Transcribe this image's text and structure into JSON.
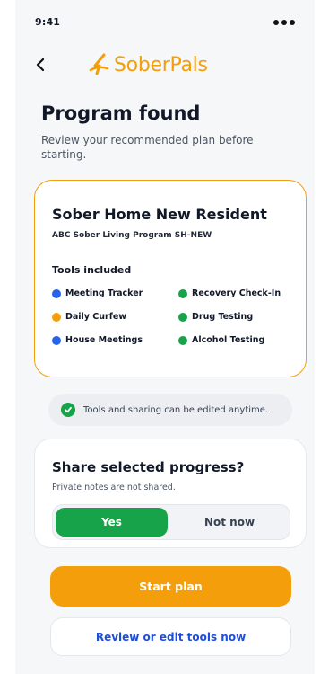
{
  "status_bar": {
    "time": "9:41"
  },
  "nav": {
    "logo_text": "SoberPals",
    "logo_color": "#f59e0b"
  },
  "header": {
    "title": "Program found",
    "subtitle": "Review your recommended plan before starting."
  },
  "program": {
    "name": "Sober Home New Resident",
    "code": "ABC Sober Living Program SH-NEW",
    "tools_heading": "Tools included",
    "tools": [
      {
        "label": "Meeting Tracker",
        "color": "#2563eb"
      },
      {
        "label": "Recovery Check-In",
        "color": "#16a34a"
      },
      {
        "label": "Daily Curfew",
        "color": "#f59e0b"
      },
      {
        "label": "Drug Testing",
        "color": "#16a34a"
      },
      {
        "label": "House Meetings",
        "color": "#2563eb"
      },
      {
        "label": "Alcohol Testing",
        "color": "#16a34a"
      }
    ]
  },
  "info": {
    "text": "Tools and sharing can be edited anytime.",
    "icon": "check-circle-icon"
  },
  "share": {
    "title": "Share selected progress?",
    "note": "Private notes are not shared.",
    "options": [
      "Yes",
      "Not now"
    ],
    "selected": "Yes"
  },
  "actions": {
    "primary": "Start plan",
    "secondary": "Review or edit tools now"
  },
  "colors": {
    "accent": "#f59e0b",
    "success": "#16a34a",
    "link": "#1d4ed8"
  }
}
